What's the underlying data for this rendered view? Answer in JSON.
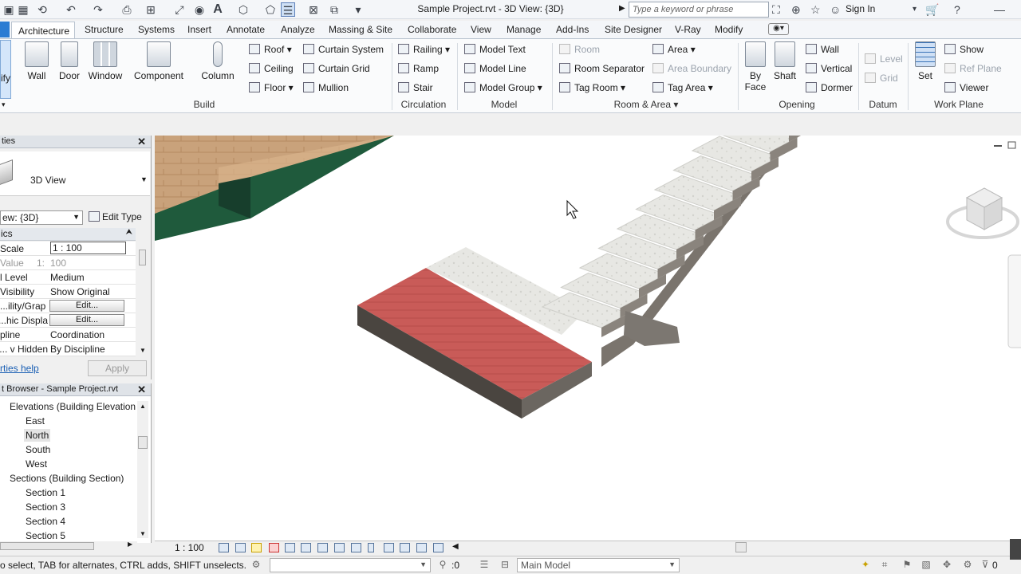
{
  "title_bar": {
    "title": "Sample Project.rvt - 3D View: {3D}",
    "search_placeholder": "Type a keyword or phrase",
    "sign_in": "Sign In"
  },
  "tabs": [
    "Architecture",
    "Structure",
    "Systems",
    "Insert",
    "Annotate",
    "Analyze",
    "Massing & Site",
    "Collaborate",
    "View",
    "Manage",
    "Add-Ins",
    "Site Designer",
    "V-Ray",
    "Modify"
  ],
  "ribbon": {
    "modify_label": "ify",
    "build": {
      "wall": "Wall",
      "door": "Door",
      "window": "Window",
      "component": "Component",
      "column": "Column",
      "roof": "Roof",
      "ceiling": "Ceiling",
      "floor": "Floor",
      "curtain_system": "Curtain System",
      "curtain_grid": "Curtain Grid",
      "mullion": "Mullion",
      "label": "Build"
    },
    "circulation": {
      "railing": "Railing",
      "ramp": "Ramp",
      "stair": "Stair",
      "label": "Circulation"
    },
    "model": {
      "model_text": "Model Text",
      "model_line": "Model Line",
      "model_group": "Model Group",
      "label": "Model"
    },
    "room_area": {
      "room": "Room",
      "room_separator": "Room Separator",
      "tag_room": "Tag Room",
      "area": "Area",
      "area_boundary": "Area Boundary",
      "tag_area": "Tag Area",
      "label": "Room & Area"
    },
    "opening": {
      "by_face_1": "By",
      "by_face_2": "Face",
      "shaft": "Shaft",
      "wall": "Wall",
      "vertical": "Vertical",
      "dormer": "Dormer",
      "label": "Opening"
    },
    "datum": {
      "level": "Level",
      "grid": "Grid",
      "label": "Datum"
    },
    "work_plane": {
      "set": "Set",
      "show": "Show",
      "ref_plane": "Ref Plane",
      "viewer": "Viewer",
      "label": "Work Plane"
    }
  },
  "properties": {
    "header": "ties",
    "type_name": "3D View",
    "view_selector": "ew: {3D}",
    "edit_type": "Edit Type",
    "section": "ics",
    "rows": [
      {
        "key": "Scale",
        "value": "1 : 100"
      },
      {
        "key": "Value",
        "value": "100"
      },
      {
        "key": "l Level",
        "value": "Medium"
      },
      {
        "key": "Visibility",
        "value": "Show Original"
      },
      {
        "key": "ility/Grap...",
        "value": "Edit..."
      },
      {
        "key": "hic Displa...",
        "value": "Edit..."
      },
      {
        "key": "pline",
        "value": "Coordination"
      },
      {
        "key": "v Hidden ...",
        "value": "By Discipline"
      }
    ],
    "scale_value_suffix": "1:",
    "help_link": "rties help",
    "apply": "Apply"
  },
  "project_browser": {
    "header": "t Browser - Sample Project.rvt",
    "elevations_group": "Elevations (Building Elevation",
    "elevations": [
      "East",
      "North",
      "South",
      "West"
    ],
    "sections_group": "Sections (Building Section)",
    "sections": [
      "Section 1",
      "Section 3",
      "Section 4",
      "Section 5"
    ]
  },
  "view_control_bar": {
    "scale": "1 : 100"
  },
  "status_bar": {
    "message": "o select, TAB for alternates, CTRL adds, SHIFT unselects.",
    "count": ":0",
    "model": "Main Model",
    "filter_count": "0"
  },
  "colors": {
    "tab_active": "#ffffff",
    "ribbon_bg": "#fafbfc",
    "floor_red": "#c95b58",
    "wall_green": "#1f5a3c",
    "stone": "#e6e6e4"
  }
}
